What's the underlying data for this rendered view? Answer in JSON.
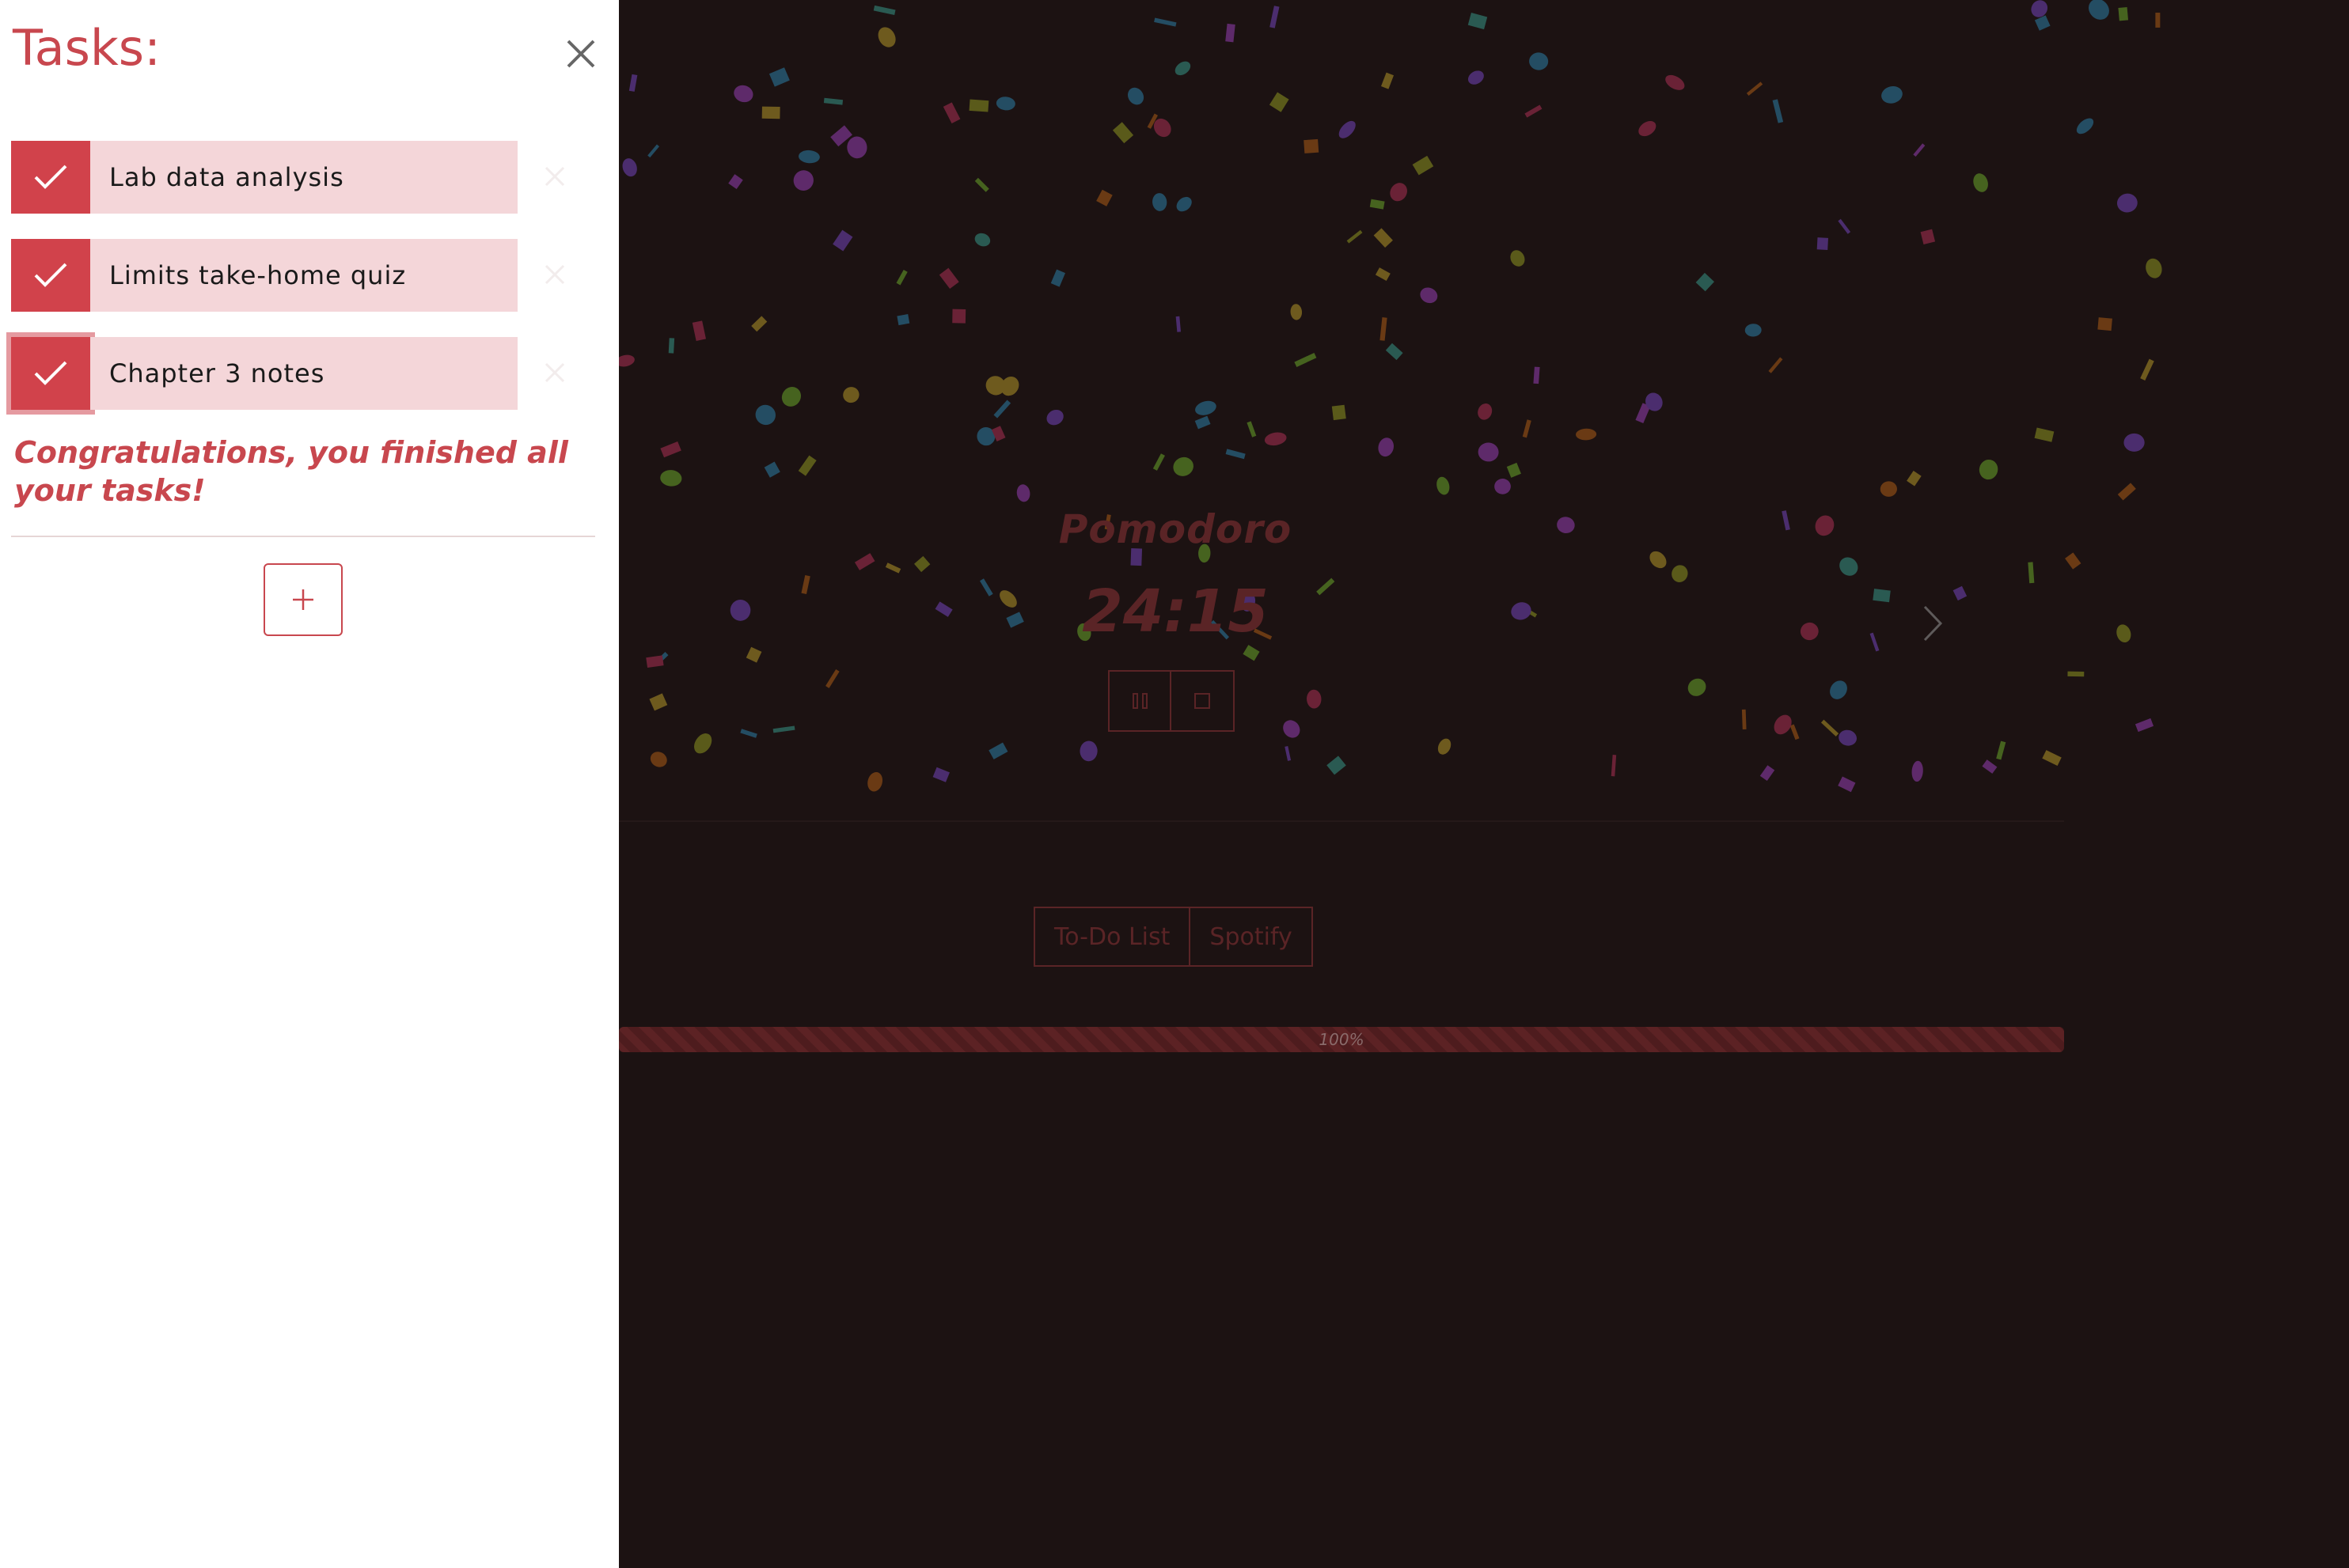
{
  "drawer": {
    "title": "Tasks:",
    "tasks": [
      {
        "label": "Lab data analysis",
        "done": true
      },
      {
        "label": "Limits take-home quiz",
        "done": true
      },
      {
        "label": "Chapter 3 notes",
        "done": true
      }
    ],
    "congrats": "Congratulations, you finished all your tasks!",
    "icons": {
      "close": "close-icon",
      "check": "checkmark-icon",
      "delete": "delete-task-icon",
      "add": "plus-icon"
    }
  },
  "timer": {
    "mode": "Pomodoro",
    "time": "24:15",
    "controls": [
      "pause-icon",
      "stop-icon"
    ]
  },
  "tabs": [
    "To-Do List",
    "Spotify"
  ],
  "progress": {
    "label": "100%",
    "value": 1.0
  },
  "colors": {
    "accent": "#c8474e",
    "check_bg": "#d1424b",
    "task_bg": "#f4d6d9",
    "overlay_bg": "#1c1212",
    "dim_accent": "#5a2426"
  }
}
